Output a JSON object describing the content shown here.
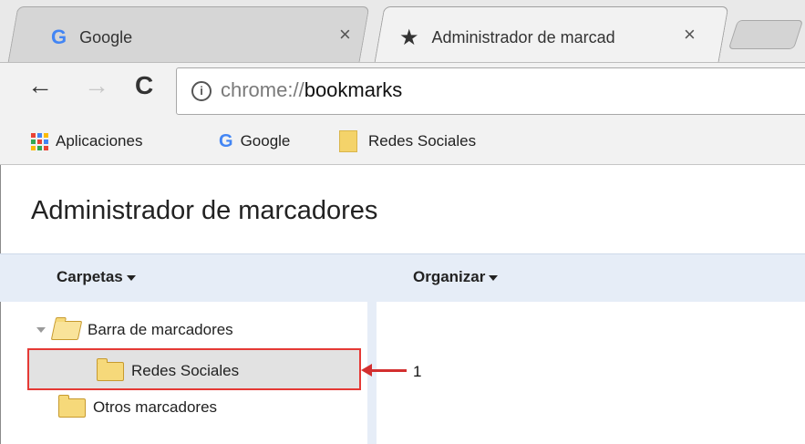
{
  "tabs": [
    {
      "label": "Google",
      "close": "×"
    },
    {
      "label": "Administrador de marcad",
      "close": "×"
    }
  ],
  "toolbar": {
    "back": "←",
    "forward": "→",
    "reload": "C",
    "info": "i",
    "url_scheme": "chrome://",
    "url_host": "bookmarks"
  },
  "bookmarks_bar": [
    {
      "label": "Aplicaciones",
      "icon": "apps-icon"
    },
    {
      "label": "Google",
      "icon": "google-g-icon"
    },
    {
      "label": "Redes Sociales",
      "icon": "folder-icon"
    }
  ],
  "page": {
    "title": "Administrador de marcadores",
    "left_header": "Carpetas",
    "right_header": "Organizar"
  },
  "tree": [
    {
      "label": "Barra de marcadores"
    },
    {
      "label": "Redes Sociales"
    },
    {
      "label": "Otros marcadores"
    }
  ],
  "annotation": {
    "label": "1"
  },
  "colors": {
    "google_blue": "#4285f4",
    "google_red": "#ea4335",
    "google_yellow": "#fbbc05",
    "google_green": "#34a853",
    "highlight_red": "#e53935"
  }
}
